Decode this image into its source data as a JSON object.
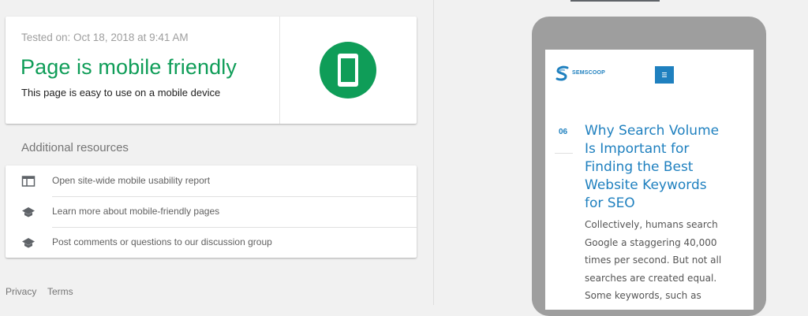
{
  "result": {
    "tested_on": "Tested on: Oct 18, 2018 at 9:41 AM",
    "verdict": "Page is mobile friendly",
    "verdict_detail": "This page is easy to use on a mobile device",
    "badge_icon": "smartphone-icon",
    "accent_color": "#0f9d58"
  },
  "resources": {
    "title": "Additional resources",
    "items": [
      {
        "label": "Open site-wide mobile usability report",
        "icon": "web-report-icon"
      },
      {
        "label": "Learn more about mobile-friendly pages",
        "icon": "school-icon"
      },
      {
        "label": "Post comments or questions to our discussion group",
        "icon": "school-icon"
      }
    ]
  },
  "footer": {
    "privacy": "Privacy",
    "terms": "Terms"
  },
  "preview": {
    "logo_text": "SEMSCOOP",
    "menu_icon": "hamburger-menu-icon",
    "date_day": "06",
    "post_title": "Why Search Volume Is Important for Finding the Best Website Keywords for SEO",
    "post_excerpt": "Collectively, humans search Google a staggering 40,000 times per second. But not all searches are created equal. Some keywords, such as",
    "brand_color": "#1f80bf"
  }
}
